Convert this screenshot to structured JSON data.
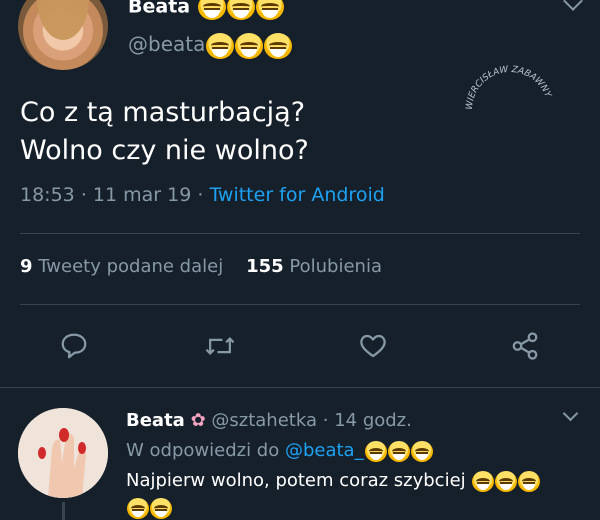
{
  "tweet": {
    "author_name": "Beata",
    "author_handle": "@beata",
    "text_line1": "Co z tą masturbacją?",
    "text_line2": "Wolno czy nie wolno?",
    "time": "18:53",
    "date": "11 mar 19",
    "source": "Twitter for Android",
    "retweets_count": "9",
    "retweets_label": "Tweety podane dalej",
    "likes_count": "155",
    "likes_label": "Polubienia"
  },
  "watermark": "WIERCISŁAW ZABAWNY",
  "reply": {
    "author_name": "Beata",
    "author_handle": "@sztahetka",
    "separator": "·",
    "time_ago": "14 godz.",
    "in_reply_prefix": "W odpowiedzi do",
    "in_reply_handle": "@beata_",
    "text": "Najpierw wolno,  potem coraz szybciej"
  },
  "icons": {
    "emoji": "laughing-face-emoji",
    "reply": "reply-icon",
    "retweet": "retweet-icon",
    "like": "heart-icon",
    "share": "share-icon",
    "flower": "cherry-blossom-emoji",
    "chevron": "chevron-down-icon"
  },
  "colors": {
    "background": "#15202b",
    "accent": "#1da1f2",
    "secondary_text": "#8899a6",
    "divider": "#38444d"
  }
}
